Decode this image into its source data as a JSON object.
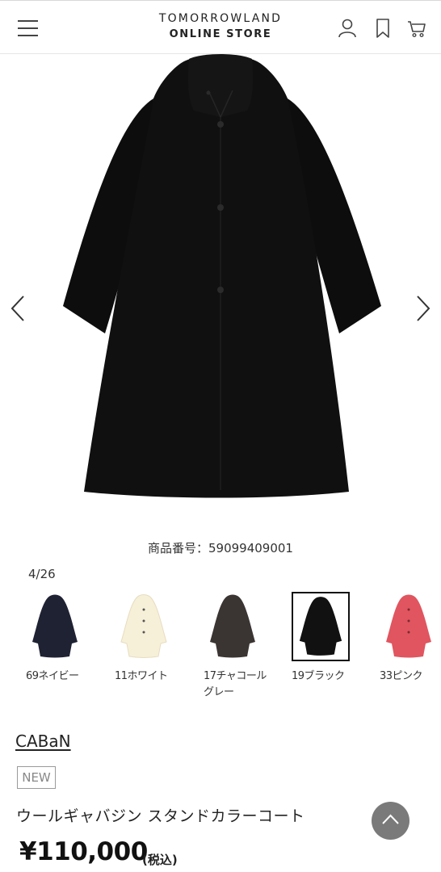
{
  "header": {
    "logo_line1": "TOMORROWLAND",
    "logo_line2": "ONLINE STORE",
    "menu_icon": "hamburger-menu-icon",
    "account_icon": "user-icon",
    "bookmark_icon": "bookmark-icon",
    "cart_icon": "cart-icon"
  },
  "gallery": {
    "product_number": "商品番号：59099409001",
    "counter": "4/26",
    "prev_icon": "chevron-left-icon",
    "next_icon": "chevron-right-icon"
  },
  "colors": [
    {
      "label": "69ネイビー",
      "swatch": "#1f2233"
    },
    {
      "label": "11ホワイト",
      "swatch": "#f7f0d8"
    },
    {
      "label": "17チャコール\nグレー",
      "label_line1": "17チャコール",
      "label_line2": "グレー",
      "swatch": "#3a3432"
    },
    {
      "label": "19ブラック",
      "swatch": "#111111",
      "selected": true
    },
    {
      "label": "33ピンク",
      "swatch": "#e0555f"
    }
  ],
  "product": {
    "brand": "CABaN",
    "badge": "NEW",
    "name": "ウールギャバジン スタンドカラーコート",
    "price": "¥110,000",
    "tax_note": "(税込)"
  },
  "scroll_top_icon": "chevron-up-icon"
}
